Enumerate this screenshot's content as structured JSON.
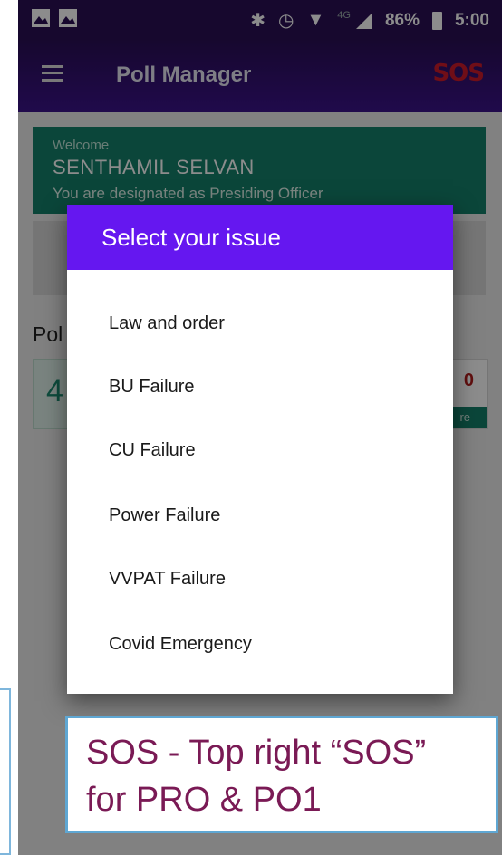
{
  "status_bar": {
    "bluetooth_icon": "bluetooth-icon",
    "alarm_icon": "alarm-icon",
    "wifi_icon": "wifi-icon",
    "network_label": "4G",
    "battery_percent": "86%",
    "time": "5:00"
  },
  "app_bar": {
    "title": "Poll Manager",
    "sos_label": "SOS"
  },
  "welcome_card": {
    "greeting": "Welcome",
    "name": "SENTHAMIL SELVAN",
    "designation": "You are designated as Presiding Officer"
  },
  "background": {
    "poll_label": "Pol",
    "count_value": "4",
    "right_value": "0",
    "right_caption": "re"
  },
  "dialog": {
    "title": "Select your issue",
    "options": [
      "Law and order",
      "BU Failure",
      "CU Failure",
      "Power Failure",
      "VVPAT Failure",
      "Covid Emergency"
    ]
  },
  "annotation": {
    "line1": "SOS - Top right “SOS”",
    "line2": "for PRO & PO1"
  },
  "colors": {
    "appbar": "#2a0f55",
    "dialog_header": "#6517f0",
    "sos": "#cc1a2a",
    "welcome_card": "#14806a",
    "callout_border": "#5fa7d3",
    "callout_text": "#7a1a55"
  }
}
